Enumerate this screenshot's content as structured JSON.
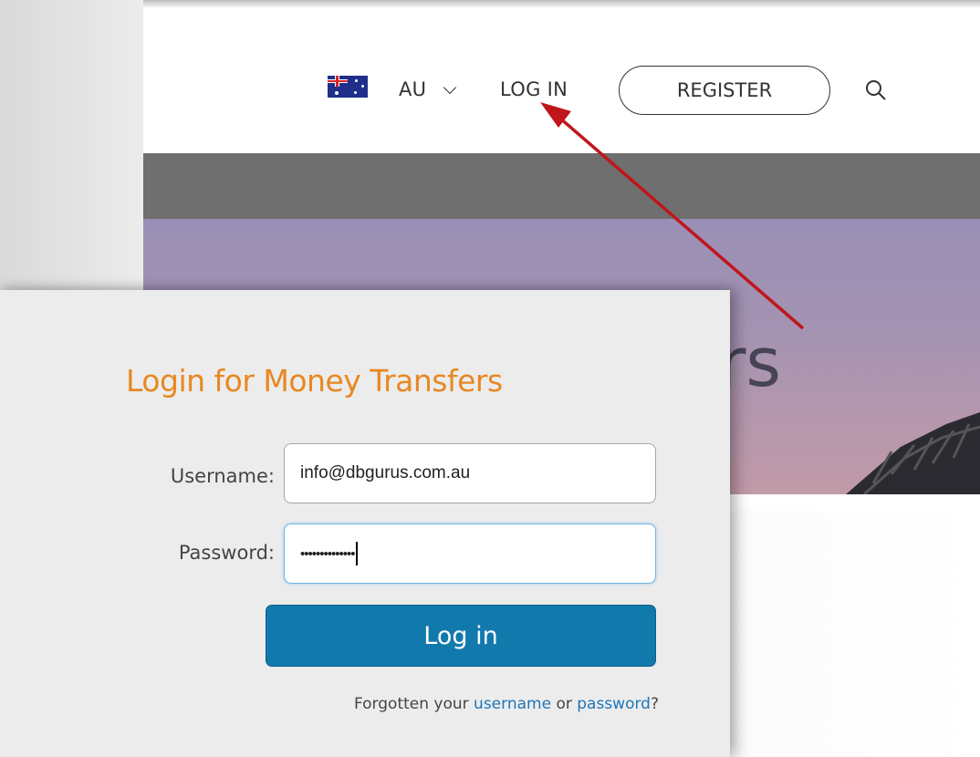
{
  "header": {
    "region_code": "AU",
    "login_label": "LOG IN",
    "register_label": "REGISTER"
  },
  "hero": {
    "text_fragment": "rs"
  },
  "login_card": {
    "title": "Login for Money Transfers",
    "username_label": "Username:",
    "username_value": "info@dbgurus.com.au",
    "password_label": "Password:",
    "password_value": "••••••••••••••",
    "submit_label": "Log in",
    "forgot_prefix": "Forgotten your",
    "forgot_username": "username",
    "forgot_or": "or",
    "forgot_password": "password",
    "forgot_suffix": "?"
  },
  "colors": {
    "accent_orange": "#e88821",
    "button_blue": "#1279ad",
    "link_blue": "#1f76b7",
    "arrow_red": "#c0161b"
  },
  "icons": {
    "flag": "australia-flag-icon",
    "search": "search-icon",
    "dropdown": "chevron-down-icon"
  }
}
